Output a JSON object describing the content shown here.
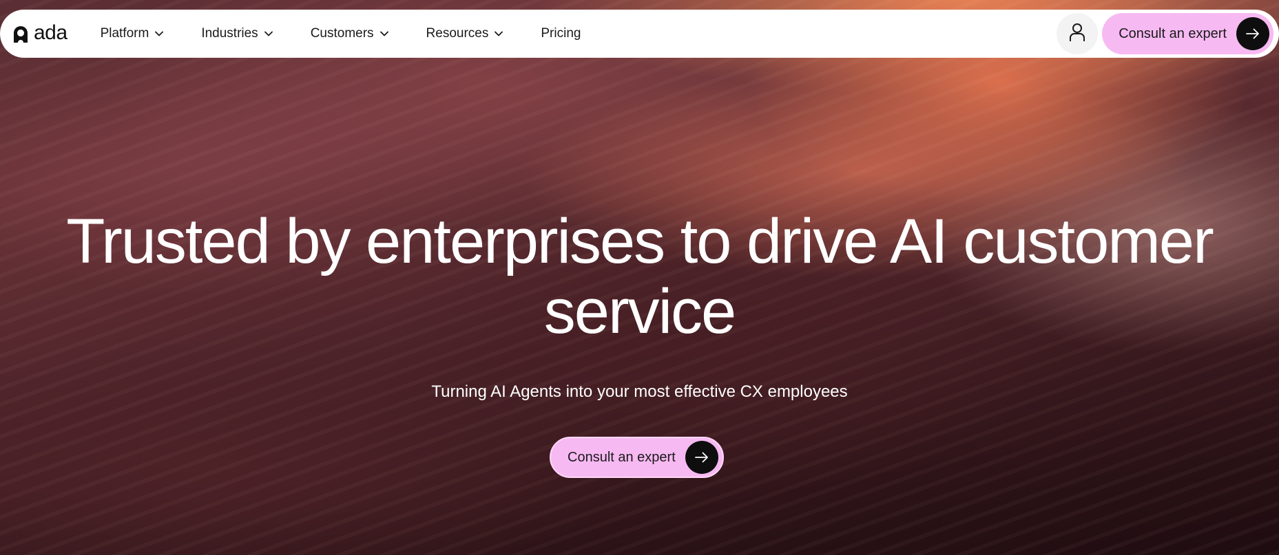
{
  "brand": {
    "name": "ada",
    "logo_icon": "ada-arch-logo-icon"
  },
  "nav": {
    "items": [
      {
        "label": "Platform",
        "has_dropdown": true
      },
      {
        "label": "Industries",
        "has_dropdown": true
      },
      {
        "label": "Customers",
        "has_dropdown": true
      },
      {
        "label": "Resources",
        "has_dropdown": true
      },
      {
        "label": "Pricing",
        "has_dropdown": false
      }
    ],
    "account_icon": "user-icon",
    "cta_label": "Consult an expert",
    "cta_icon": "arrow-right-icon"
  },
  "hero": {
    "title": "Trusted by enterprises to drive AI customer service",
    "subtitle": "Turning AI Agents into your most effective CX employees",
    "cta_label": "Consult an expert",
    "cta_icon": "arrow-right-icon"
  },
  "colors": {
    "cta_background": "#f7b9f2",
    "arrow_circle": "#0e0e0e",
    "navbar_background": "#ffffff",
    "hero_text": "#ffffff"
  }
}
